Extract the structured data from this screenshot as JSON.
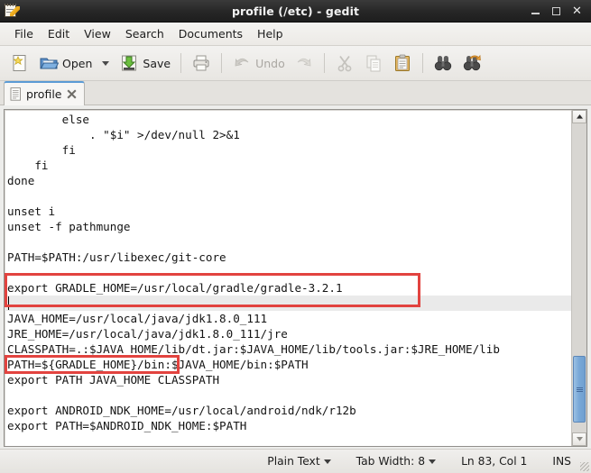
{
  "window": {
    "title": "profile (/etc) - gedit",
    "app_icon": "gedit-notepad-pencil-icon",
    "controls": {
      "minimize": "minimize-button",
      "maximize": "maximize-button",
      "close": "close-button"
    }
  },
  "menubar": {
    "items": [
      {
        "label": "File",
        "name": "menu-file"
      },
      {
        "label": "Edit",
        "name": "menu-edit"
      },
      {
        "label": "View",
        "name": "menu-view"
      },
      {
        "label": "Search",
        "name": "menu-search"
      },
      {
        "label": "Documents",
        "name": "menu-documents"
      },
      {
        "label": "Help",
        "name": "menu-help"
      }
    ]
  },
  "toolbar": {
    "new_label": "",
    "open_label": "Open",
    "save_label": "Save",
    "print_label": "",
    "undo_label": "Undo",
    "redo_label": "",
    "cut_label": "",
    "copy_label": "",
    "paste_label": "",
    "find_label": "",
    "replace_label": ""
  },
  "tabs": [
    {
      "label": "profile",
      "name": "tab-profile",
      "active": true
    }
  ],
  "editor": {
    "lines": [
      "        else",
      "            . \"$i\" >/dev/null 2>&1",
      "        fi",
      "    fi",
      "done",
      "",
      "unset i",
      "unset -f pathmunge",
      "",
      "PATH=$PATH:/usr/libexec/git-core",
      "",
      "export GRADLE_HOME=/usr/local/gradle/gradle-3.2.1",
      "",
      "JAVA_HOME=/usr/local/java/jdk1.8.0_111",
      "JRE_HOME=/usr/local/java/jdk1.8.0_111/jre",
      "CLASSPATH=.:$JAVA_HOME/lib/dt.jar:$JAVA_HOME/lib/tools.jar:$JRE_HOME/lib",
      "PATH=${GRADLE_HOME}/bin:$JAVA_HOME/bin:$PATH",
      "export PATH JAVA_HOME CLASSPATH",
      "",
      "export ANDROID_NDK_HOME=/usr/local/android/ndk/r12b",
      "export PATH=$ANDROID_NDK_HOME:$PATH"
    ],
    "current_line_index": 12,
    "annotation_color": "#e2433f",
    "annotations": [
      {
        "name": "gradle-home-export-highlight",
        "target_line_index": 11
      },
      {
        "name": "gradle-home-path-highlight",
        "target_line_index": 16
      }
    ]
  },
  "statusbar": {
    "language": "Plain Text",
    "tab_width_label": "Tab Width:",
    "tab_width_value": "8",
    "position": "Ln 83, Col 1",
    "insert_mode": "INS"
  }
}
